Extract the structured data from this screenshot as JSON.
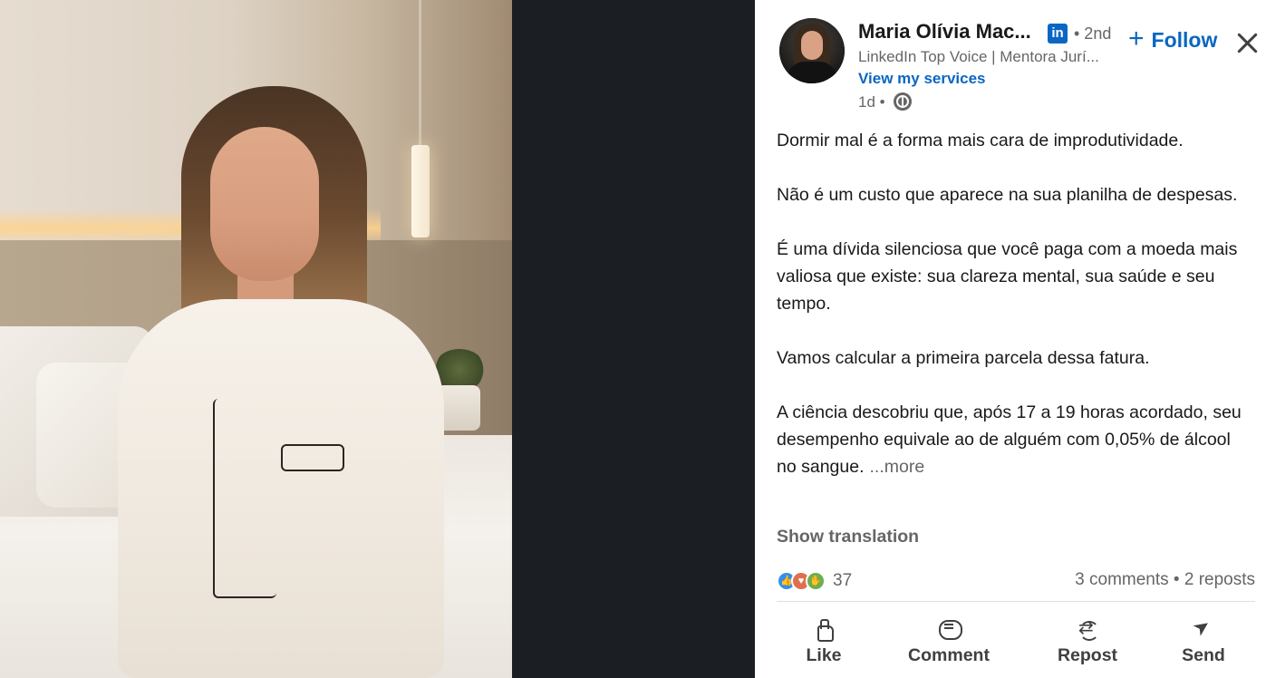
{
  "author": {
    "name": "Maria Olívia Mac...",
    "badge": "in",
    "degree": "• 2nd",
    "headline": "LinkedIn Top Voice | Mentora Jurí...",
    "view_services": "View my services",
    "timestamp": "1d •"
  },
  "follow": {
    "label": "Follow",
    "plus": "+"
  },
  "post": {
    "paragraphs": [
      "Dormir mal é a forma mais cara de improdutividade.",
      "Não é um custo que aparece na sua planilha de despesas.",
      "É uma dívida silenciosa que você paga com a moeda mais valiosa que existe: sua clareza mental, sua saúde e seu tempo.",
      "Vamos calcular a primeira parcela dessa fatura.",
      "A ciência descobriu que, após 17 a 19 horas acordado, seu desempenho equivale ao de alguém com 0,05% de álcool no sangue."
    ],
    "more": "...more"
  },
  "show_translation": "Show translation",
  "reactions": {
    "count": "37",
    "icons": [
      "like-icon",
      "love-icon",
      "support-icon"
    ],
    "colors": {
      "like": "#378fe9",
      "love": "#df704d",
      "support": "#6dae4f"
    }
  },
  "social_counts": "3 comments • 2 reposts",
  "actions": {
    "like": "Like",
    "comment": "Comment",
    "repost": "Repost",
    "send": "Send"
  },
  "colors": {
    "link": "#0a66c2",
    "muted": "#666666",
    "text": "#191919",
    "viewer_bg": "#1b1f23"
  }
}
